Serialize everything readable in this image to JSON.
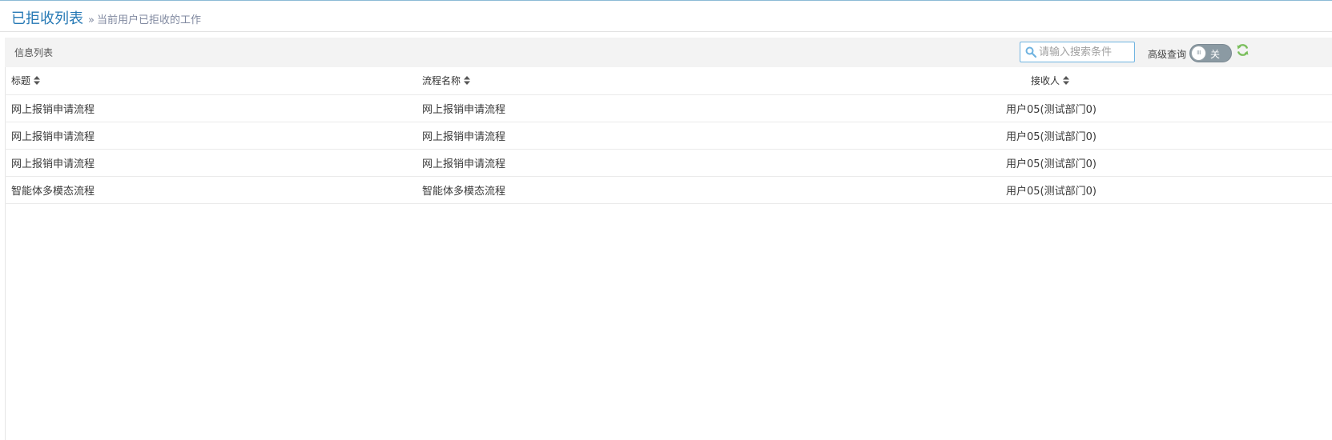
{
  "header": {
    "title": "已拒收列表",
    "breadcrumb_separator": "»",
    "subtitle": "当前用户已拒收的工作"
  },
  "toolbar": {
    "title": "信息列表",
    "search_placeholder": "请输入搜索条件",
    "search_value": "",
    "advanced_label": "高级查询",
    "toggle_knob_text": "III",
    "toggle_state_text": "关"
  },
  "table": {
    "columns": [
      "标题",
      "流程名称",
      "接收人"
    ],
    "rows": [
      [
        "网上报销申请流程",
        "网上报销申请流程",
        "用户05(测试部门0)"
      ],
      [
        "网上报销申请流程",
        "网上报销申请流程",
        "用户05(测试部门0)"
      ],
      [
        "网上报销申请流程",
        "网上报销申请流程",
        "用户05(测试部门0)"
      ],
      [
        "智能体多模态流程",
        "智能体多模态流程",
        "用户05(测试部门0)"
      ]
    ]
  },
  "icons": {
    "search": "search-icon",
    "refresh": "refresh-icon",
    "sort": "sort-icon"
  },
  "colors": {
    "title_blue": "#2679b5",
    "search_border": "#6fb3e0",
    "refresh_green": "#7bbf5d",
    "toggle_grey": "#8b9aa3"
  }
}
